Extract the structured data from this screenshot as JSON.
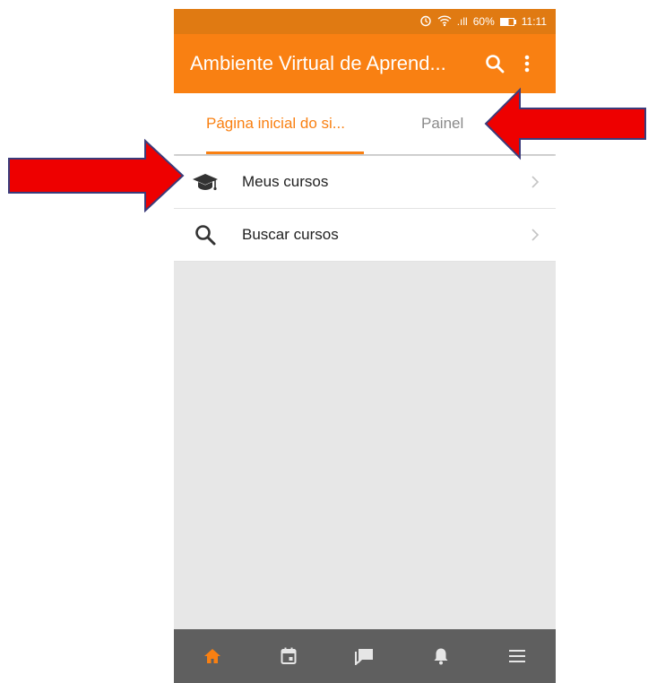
{
  "status_bar": {
    "signal": ".ıll",
    "battery": "60%",
    "time": "11:11"
  },
  "app_bar": {
    "title": "Ambiente Virtual de Aprend..."
  },
  "tabs": [
    {
      "label": "Página inicial do si..."
    },
    {
      "label": "Painel"
    }
  ],
  "menu": [
    {
      "label": "Meus cursos",
      "icon": "graduation-cap-icon"
    },
    {
      "label": "Buscar cursos",
      "icon": "search-icon"
    }
  ],
  "bottom_nav": [
    "home-icon",
    "calendar-icon",
    "messages-icon",
    "notifications-icon",
    "menu-icon"
  ],
  "colors": {
    "primary": "#f98012",
    "status_bar": "#e07a12",
    "bottom_nav": "#5f5f5f",
    "annotation_arrow": "#ee0000"
  }
}
